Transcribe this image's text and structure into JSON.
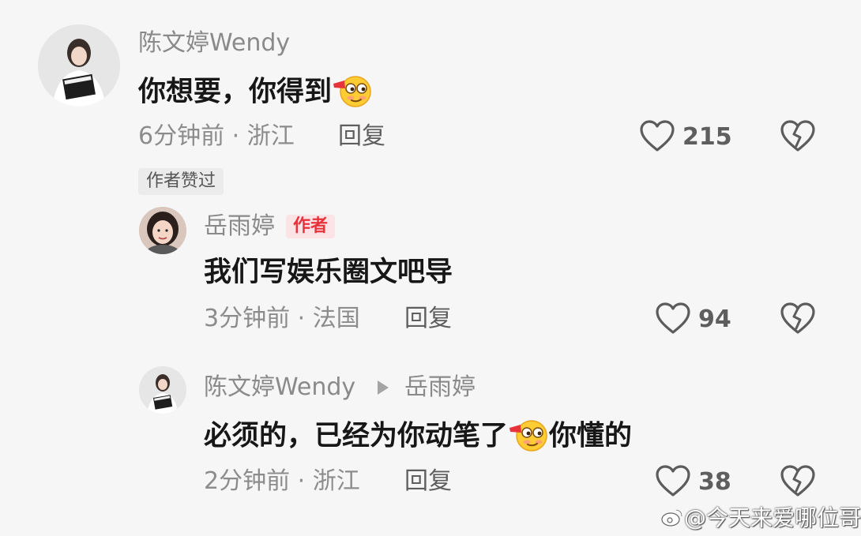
{
  "comments": [
    {
      "user": "陈文婷Wendy",
      "text": "你想要，你得到",
      "time": "6分钟前",
      "location": "浙江",
      "reply_label": "回复",
      "likes": "215",
      "liked_badge": "作者赞过",
      "emoji": "smirk-blushing-emoji"
    },
    {
      "user": "岳雨婷",
      "author_tag": "作者",
      "text": "我们写娱乐圈文吧导",
      "time": "3分钟前",
      "location": "法国",
      "reply_label": "回复",
      "likes": "94"
    },
    {
      "user": "陈文婷Wendy",
      "reply_to": "岳雨婷",
      "text_before": "必须的，已经为你动笔了",
      "text_after": "你懂的",
      "time": "2分钟前",
      "location": "浙江",
      "reply_label": "回复",
      "likes": "38",
      "emoji": "smirk-blushing-emoji"
    }
  ],
  "separator": "·",
  "icons": {
    "like": "heart-outline-icon",
    "dislike": "broken-heart-icon",
    "reply_arrow": "play-arrow-icon"
  },
  "colors": {
    "author_tag_text": "#e8323c",
    "author_tag_bg": "#fce3e5",
    "muted_text": "#8c8c8c",
    "background": "#f6f6f6"
  },
  "watermark": "@今天来爱哪位哥哥"
}
